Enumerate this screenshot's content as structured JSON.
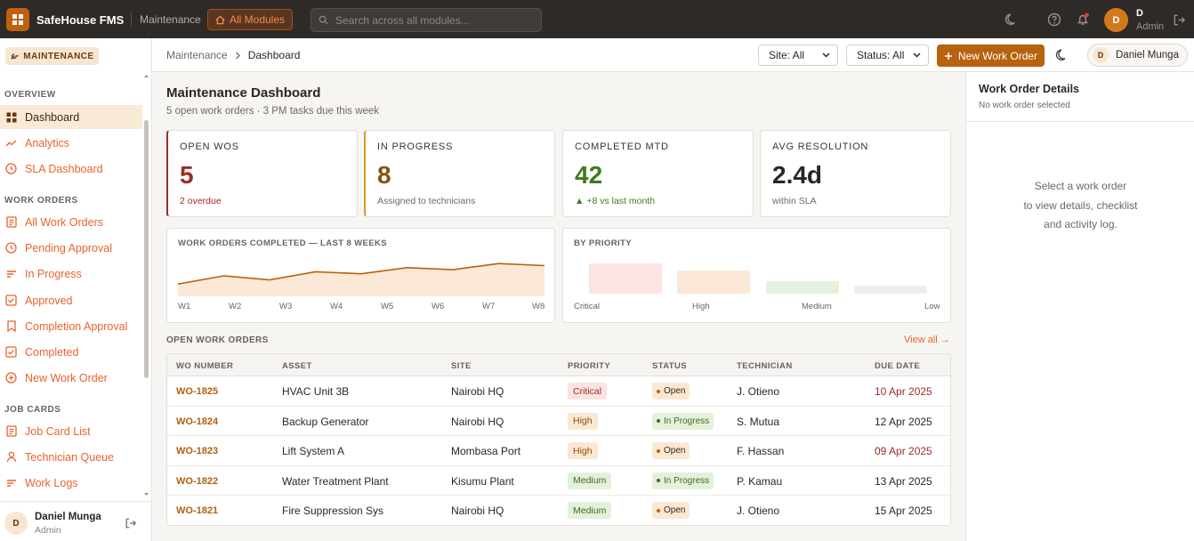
{
  "topbar": {
    "brand": "SafeHouse FMS",
    "crumb": "Maintenance",
    "all_modules": "All Modules",
    "search_placeholder": "Search across all modules...",
    "user_initial": "D",
    "user_name": "D",
    "user_role": "Admin"
  },
  "sidebar": {
    "module_label": "MAINTENANCE",
    "sections": {
      "overview": "OVERVIEW",
      "work_orders": "WORK ORDERS",
      "job_cards": "JOB CARDS"
    },
    "items": [
      {
        "label": "Dashboard",
        "icon": "grid-icon"
      },
      {
        "label": "Analytics",
        "icon": "trend-icon"
      },
      {
        "label": "SLA Dashboard",
        "icon": "clock-icon"
      },
      {
        "label": "All Work Orders",
        "icon": "list-doc-icon"
      },
      {
        "label": "Pending Approval",
        "icon": "clock-icon"
      },
      {
        "label": "In Progress",
        "icon": "lines-icon"
      },
      {
        "label": "Approved",
        "icon": "check-square-icon"
      },
      {
        "label": "Completion Approval",
        "icon": "bookmark-icon"
      },
      {
        "label": "Completed",
        "icon": "check-square-icon"
      },
      {
        "label": "New Work Order",
        "icon": "plus-circle-icon"
      },
      {
        "label": "Job Card List",
        "icon": "list-doc-icon"
      },
      {
        "label": "Technician Queue",
        "icon": "user-icon"
      },
      {
        "label": "Work Logs",
        "icon": "lines-icon"
      }
    ],
    "footer": {
      "initial": "D",
      "name": "Daniel Munga",
      "role": "Admin"
    }
  },
  "subheader": {
    "breadcrumb": [
      "Maintenance",
      "Dashboard"
    ],
    "site_filter": "Site: All",
    "status_filter": "Status: All",
    "new_work_order": "New Work Order",
    "user_initial": "D",
    "user_name": "Daniel Munga"
  },
  "dashboard": {
    "title": "Maintenance Dashboard",
    "subtitle": "5 open work orders · 3 PM tasks due this week",
    "kpis": [
      {
        "label": "OPEN WOS",
        "value": "5",
        "note": "2 overdue",
        "accent": "#9e2b25"
      },
      {
        "label": "IN PROGRESS",
        "value": "8",
        "note": "Assigned to technicians",
        "accent": "#d9861c"
      },
      {
        "label": "COMPLETED MTD",
        "value": "42",
        "note": "▲ +8 vs last month",
        "accent": "#3f7a1f"
      },
      {
        "label": "AVG RESOLUTION",
        "value": "2.4d",
        "note": "within SLA",
        "accent": "#2b2622"
      }
    ],
    "trend": {
      "title": "WORK ORDERS COMPLETED — LAST 8 WEEKS",
      "weeks": [
        "W1",
        "W2",
        "W3",
        "W4",
        "W5",
        "W6",
        "W7",
        "W8"
      ],
      "values": [
        29,
        31,
        30,
        32,
        31.5,
        33,
        32.5,
        34,
        33.5
      ]
    },
    "priority": {
      "title": "BY PRIORITY",
      "labels": [
        "Critical",
        "High",
        "Medium",
        "Low"
      ],
      "values": [
        4,
        3,
        1.6,
        1
      ],
      "colors": [
        "#fbe5e3",
        "#fbe8d6",
        "#e6f2dd",
        "#efede9"
      ]
    },
    "open_orders": {
      "title": "OPEN WORK ORDERS",
      "view_all": "View all →",
      "columns": [
        "WO NUMBER",
        "ASSET",
        "SITE",
        "PRIORITY",
        "STATUS",
        "TECHNICIAN",
        "DUE DATE"
      ],
      "rows": [
        {
          "wo": "WO-1825",
          "asset": "HVAC Unit 3B",
          "site": "Nairobi HQ",
          "priority": "Critical",
          "status": "Open",
          "tech": "J. Otieno",
          "due": "10 Apr 2025",
          "overdue": true
        },
        {
          "wo": "WO-1824",
          "asset": "Backup Generator",
          "site": "Nairobi HQ",
          "priority": "High",
          "status": "In Progress",
          "tech": "S. Mutua",
          "due": "12 Apr 2025",
          "overdue": false
        },
        {
          "wo": "WO-1823",
          "asset": "Lift System A",
          "site": "Mombasa Port",
          "priority": "High",
          "status": "Open",
          "tech": "F. Hassan",
          "due": "09 Apr 2025",
          "overdue": true
        },
        {
          "wo": "WO-1822",
          "asset": "Water Treatment Plant",
          "site": "Kisumu Plant",
          "priority": "Medium",
          "status": "In Progress",
          "tech": "P. Kamau",
          "due": "13 Apr 2025",
          "overdue": false
        },
        {
          "wo": "WO-1821",
          "asset": "Fire Suppression Sys",
          "site": "Nairobi HQ",
          "priority": "Medium",
          "status": "Open",
          "tech": "J. Otieno",
          "due": "15 Apr 2025",
          "overdue": false
        }
      ]
    }
  },
  "details": {
    "title": "Work Order Details",
    "subtitle": "No work order selected",
    "empty_lines": [
      "Select a work order",
      "to view details, checklist",
      "and activity log."
    ]
  }
}
